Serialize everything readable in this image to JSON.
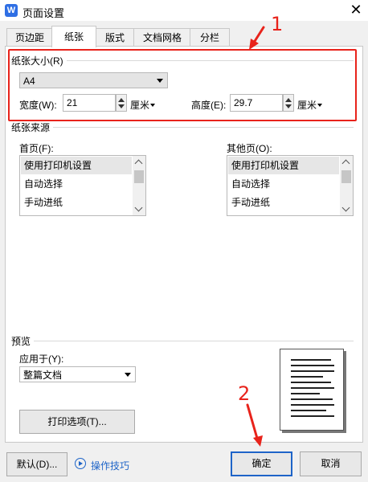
{
  "window": {
    "title": "页面设置",
    "app_icon_letter": "W"
  },
  "tabs": [
    {
      "label": "页边距",
      "active": false
    },
    {
      "label": "纸张",
      "active": true
    },
    {
      "label": "版式",
      "active": false
    },
    {
      "label": "文档网格",
      "active": false
    },
    {
      "label": "分栏",
      "active": false
    }
  ],
  "paper_size": {
    "group_label": "纸张大小(R)",
    "selected": "A4",
    "width_label": "宽度(W):",
    "width_value": "21",
    "width_unit": "厘米",
    "height_label": "高度(E):",
    "height_value": "29.7",
    "height_unit": "厘米"
  },
  "paper_source": {
    "group_label": "纸张来源",
    "first_page_label": "首页(F):",
    "other_pages_label": "其他页(O):",
    "first_page_items": [
      "使用打印机设置",
      "自动选择",
      "手动进纸"
    ],
    "other_pages_items": [
      "使用打印机设置",
      "自动选择",
      "手动进纸"
    ]
  },
  "preview": {
    "group_label": "预览",
    "apply_label": "应用于(Y):",
    "apply_selected": "整篇文档",
    "print_options_label": "打印选项(T)..."
  },
  "footer": {
    "default_label": "默认(D)...",
    "tips_label": "操作技巧",
    "ok_label": "确定",
    "cancel_label": "取消"
  },
  "annotations": {
    "num1": "1",
    "num2": "2"
  },
  "colors": {
    "annotation_red": "#e8231b",
    "link_blue": "#1e64c8",
    "app_blue": "#2f6fe4"
  }
}
